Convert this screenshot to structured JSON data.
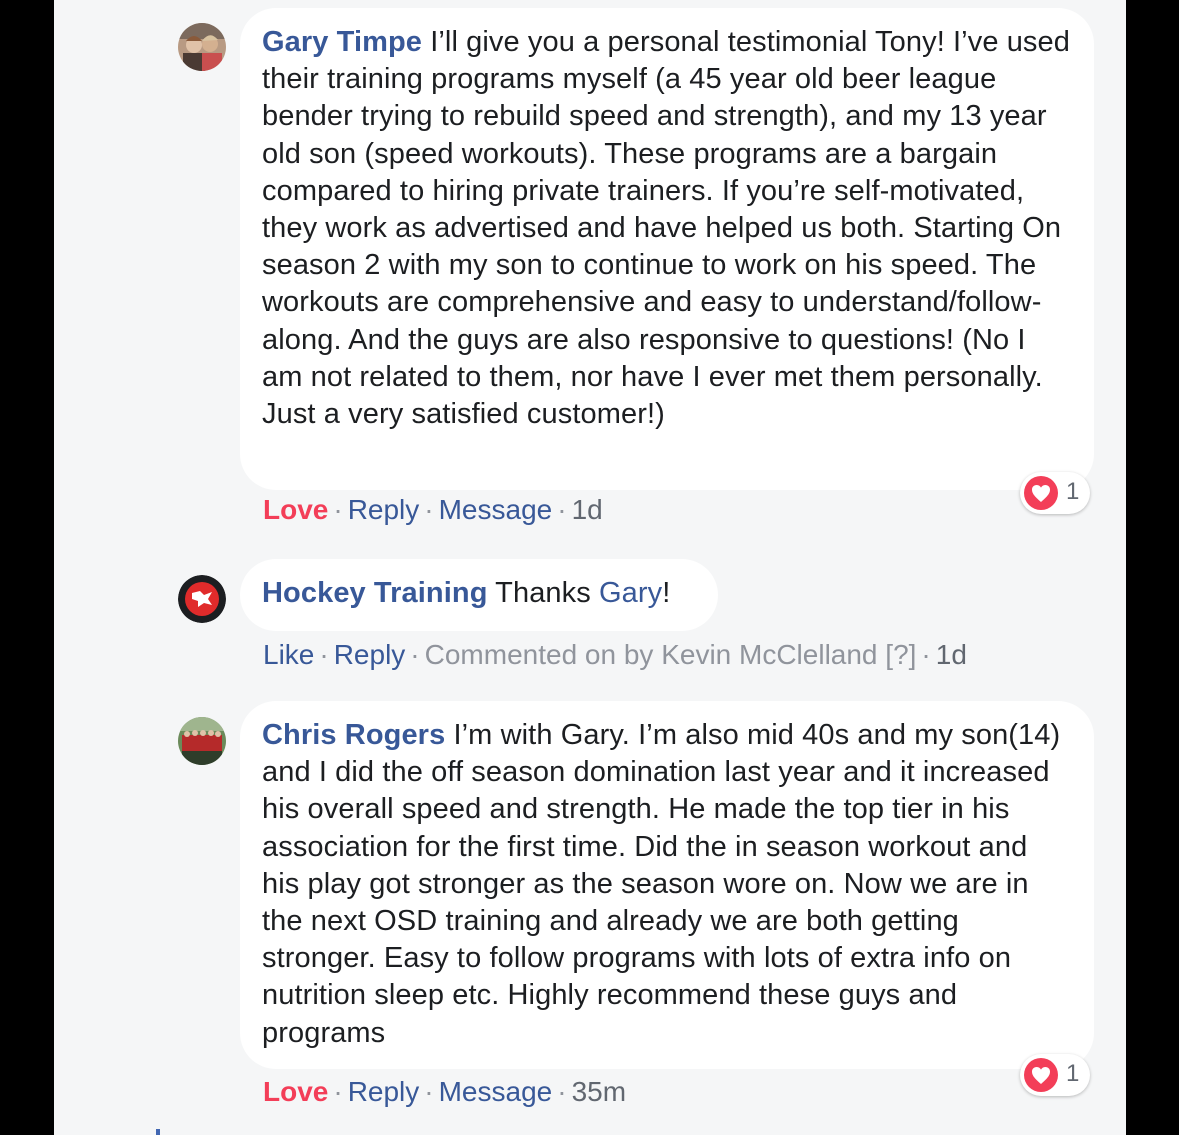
{
  "comments": [
    {
      "author": "Gary Timpe",
      "text": " I’ll give you a personal testimonial Tony! I’ve used their training programs myself (a 45 year old beer league bender trying to rebuild speed and strength), and my 13 year old son (speed workouts). These programs are a bargain compared to hiring private trainers. If you’re self-motivated, they work as advertised and have helped us both. Starting On season 2 with my son to continue to work on his speed. The workouts are comprehensive and easy to understand/follow-along. And the guys are also responsive to questions! (No I am not related to them, nor have I ever met them personally. Just a very satisfied customer!)",
      "actions": {
        "react": "Love",
        "reply": "Reply",
        "message": "Message",
        "time": "1d"
      },
      "reaction": {
        "icon": "heart-icon",
        "count": "1"
      }
    },
    {
      "author": "Hockey Training",
      "text": " Thanks ",
      "mention": "Gary",
      "text_end": "!",
      "actions": {
        "react": "Like",
        "reply": "Reply",
        "meta": "Commented on by Kevin McClelland [?]",
        "time": "1d"
      }
    },
    {
      "author": "Chris Rogers",
      "text": " I’m with Gary. I’m also mid 40s and my son(14) and I did the off season domination last year and it increased his overall speed and strength. He made the top tier in his association for the first time. Did the in season workout and his play got stronger as the season wore on. Now we are in the next OSD training and already we are both getting stronger. Easy to follow programs with lots of extra info on nutrition sleep etc. Highly recommend these guys and programs",
      "actions": {
        "react": "Love",
        "reply": "Reply",
        "message": "Message",
        "time": "35m"
      },
      "reaction": {
        "icon": "heart-icon",
        "count": "1"
      }
    }
  ],
  "separator": " · ",
  "colors": {
    "link": "#385898",
    "love": "#f33e58",
    "background": "#f5f6f7",
    "bubble": "#ffffff"
  }
}
